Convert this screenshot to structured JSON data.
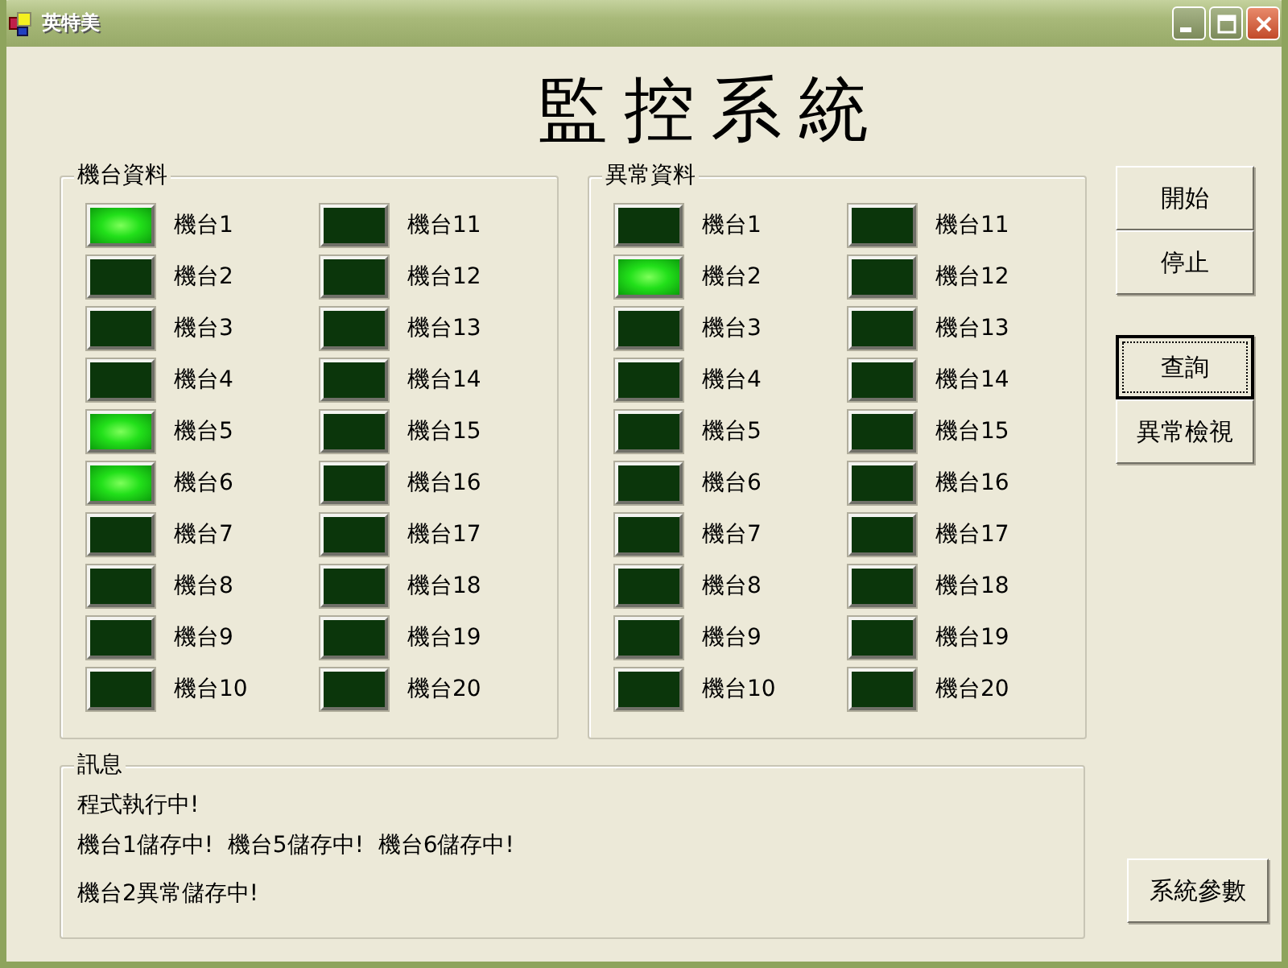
{
  "window": {
    "title": "英特美"
  },
  "heading": "監控系統",
  "groups": [
    {
      "title": "機台資料",
      "lamps": [
        {
          "label": "機台1",
          "on": true
        },
        {
          "label": "機台2",
          "on": false
        },
        {
          "label": "機台3",
          "on": false
        },
        {
          "label": "機台4",
          "on": false
        },
        {
          "label": "機台5",
          "on": true
        },
        {
          "label": "機台6",
          "on": true
        },
        {
          "label": "機台7",
          "on": false
        },
        {
          "label": "機台8",
          "on": false
        },
        {
          "label": "機台9",
          "on": false
        },
        {
          "label": "機台10",
          "on": false
        },
        {
          "label": "機台11",
          "on": false
        },
        {
          "label": "機台12",
          "on": false
        },
        {
          "label": "機台13",
          "on": false
        },
        {
          "label": "機台14",
          "on": false
        },
        {
          "label": "機台15",
          "on": false
        },
        {
          "label": "機台16",
          "on": false
        },
        {
          "label": "機台17",
          "on": false
        },
        {
          "label": "機台18",
          "on": false
        },
        {
          "label": "機台19",
          "on": false
        },
        {
          "label": "機台20",
          "on": false
        }
      ]
    },
    {
      "title": "異常資料",
      "lamps": [
        {
          "label": "機台1",
          "on": false
        },
        {
          "label": "機台2",
          "on": true
        },
        {
          "label": "機台3",
          "on": false
        },
        {
          "label": "機台4",
          "on": false
        },
        {
          "label": "機台5",
          "on": false
        },
        {
          "label": "機台6",
          "on": false
        },
        {
          "label": "機台7",
          "on": false
        },
        {
          "label": "機台8",
          "on": false
        },
        {
          "label": "機台9",
          "on": false
        },
        {
          "label": "機台10",
          "on": false
        },
        {
          "label": "機台11",
          "on": false
        },
        {
          "label": "機台12",
          "on": false
        },
        {
          "label": "機台13",
          "on": false
        },
        {
          "label": "機台14",
          "on": false
        },
        {
          "label": "機台15",
          "on": false
        },
        {
          "label": "機台16",
          "on": false
        },
        {
          "label": "機台17",
          "on": false
        },
        {
          "label": "機台18",
          "on": false
        },
        {
          "label": "機台19",
          "on": false
        },
        {
          "label": "機台20",
          "on": false
        }
      ]
    }
  ],
  "buttons": [
    {
      "label": "開始",
      "focused": false
    },
    {
      "label": "停止",
      "focused": false
    },
    {
      "label": "查詢",
      "focused": true
    },
    {
      "label": "異常檢視",
      "focused": false
    }
  ],
  "messages": {
    "title": "訊息",
    "lines": [
      "程式執行中!",
      "機台1儲存中!  機台5儲存中!  機台6儲存中!",
      "機台2異常儲存中!"
    ]
  },
  "settings_button": {
    "label": "系統參數"
  }
}
